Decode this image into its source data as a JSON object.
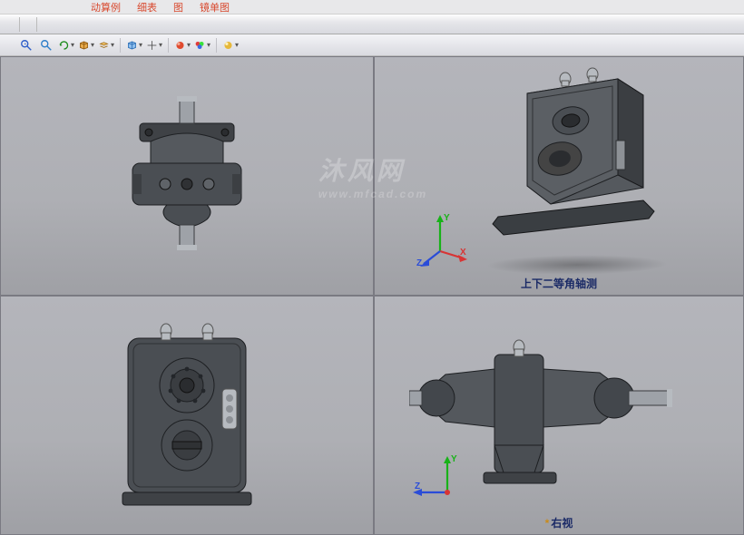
{
  "ribbon": {
    "tabs": [
      "动算例",
      "细表",
      "图",
      "镜单图"
    ]
  },
  "views": {
    "topRight_label": "上下二等角轴测",
    "bottomRight_label": "*右视",
    "asterisk": "*"
  },
  "triad": {
    "x": "X",
    "y": "Y",
    "z": "Z"
  },
  "watermark": {
    "main": "沐风网",
    "sub": "www.mfcad.com"
  },
  "colors": {
    "part_dark": "#3f4246",
    "part_mid": "#55595e",
    "part_light": "#7c8086",
    "steel": "#a9aeb4"
  }
}
